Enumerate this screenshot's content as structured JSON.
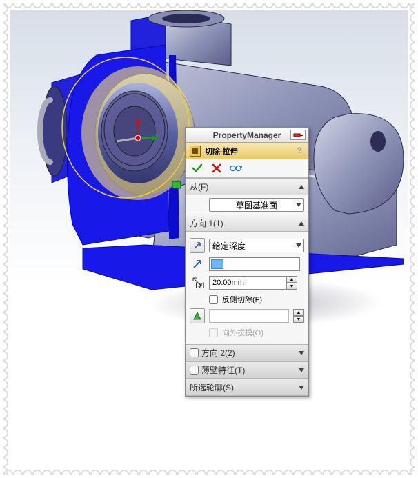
{
  "header": {
    "title": "PropertyManager"
  },
  "feature": {
    "name": "切除-拉伸"
  },
  "from": {
    "label": "从(F)",
    "selected": "草图基准面"
  },
  "direction1": {
    "label": "方向 1(1)",
    "end_condition": "给定深度",
    "depth": "20.00mm",
    "flip_side_label": "反侧切除(F)",
    "draft_outward_label": "向外拔模(O)"
  },
  "direction2": {
    "label": "方向 2(2)"
  },
  "thin_feature": {
    "label": "薄壁特征(T)"
  },
  "selected_contours": {
    "label": "所选轮廓(S)"
  },
  "icons": {
    "ok": "✓",
    "cancel": "✕",
    "glasses": "👓",
    "help": "?",
    "pin": "📌"
  }
}
